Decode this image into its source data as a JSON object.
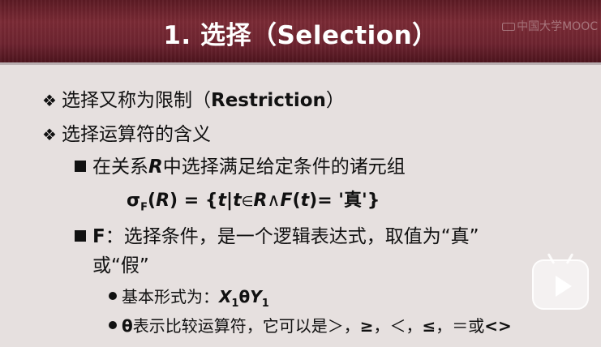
{
  "title": "1. 选择（Selection）",
  "watermark": "中国大学MOOC",
  "bullets": {
    "l1": {
      "marker": "❖",
      "text_cn": "选择又称为限制（",
      "text_b": "Restriction",
      "text_end": "）"
    },
    "l2": {
      "marker": "❖",
      "text": "选择运算符的含义"
    },
    "l3": {
      "pre": "在关系",
      "var": "R",
      "post": "中选择满足给定条件的诸元组"
    },
    "l4": {
      "sigma": "σ",
      "sub_F": "F",
      "open": "(",
      "R": "R",
      "mid": ") = {",
      "t1": "t",
      "bar": "|",
      "t2": "t",
      "in": "∈",
      "R2": "R",
      "and": "∧",
      "F": "F",
      "paren_t": "(",
      "t3": "t",
      "close": ")",
      "eq": "= '真'}"
    },
    "l5": {
      "prefix": "F",
      "text": "：选择条件，是一个逻辑表达式，取值为“真”"
    },
    "l6": {
      "text": "或“假”"
    },
    "l7": {
      "text": "基本形式为：",
      "X": "X",
      "sub1": "1",
      "theta": "θ",
      "Y": "Y",
      "sub2": "1"
    },
    "l8": {
      "theta": "θ",
      "text": "表示比较运算符，它可以是＞，",
      "ge": "≥",
      "c1": "，＜，",
      "le": "≤",
      "c2": "，＝或",
      "ne": "<>"
    }
  }
}
